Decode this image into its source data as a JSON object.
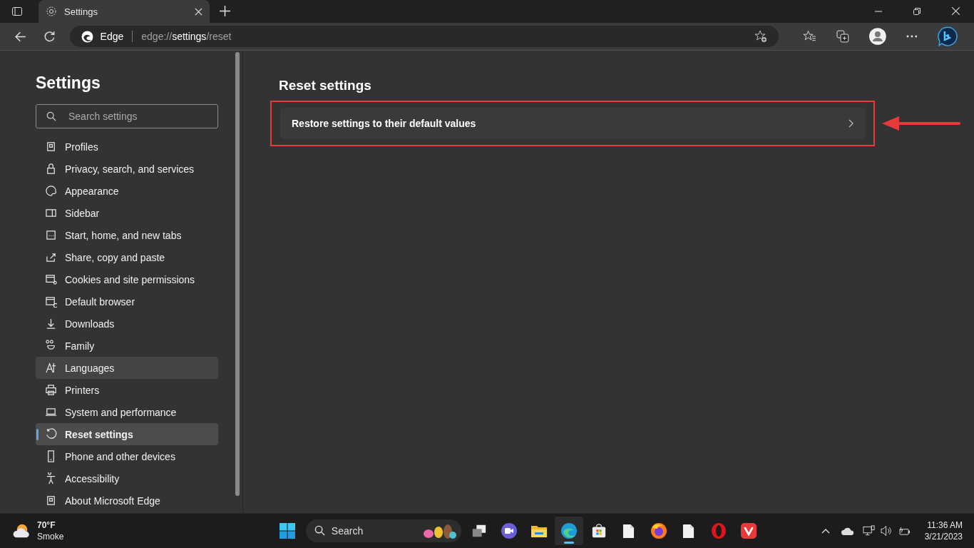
{
  "tab": {
    "title": "Settings"
  },
  "address_bar": {
    "site_label": "Edge",
    "url_scheme": "edge://",
    "url_host": "settings",
    "url_path": "/reset"
  },
  "sidebar": {
    "title": "Settings",
    "search": {
      "placeholder": "Search settings"
    },
    "items": [
      {
        "label": "Profiles",
        "selected": false,
        "hovered": false
      },
      {
        "label": "Privacy, search, and services",
        "selected": false,
        "hovered": false
      },
      {
        "label": "Appearance",
        "selected": false,
        "hovered": false
      },
      {
        "label": "Sidebar",
        "selected": false,
        "hovered": false
      },
      {
        "label": "Start, home, and new tabs",
        "selected": false,
        "hovered": false
      },
      {
        "label": "Share, copy and paste",
        "selected": false,
        "hovered": false
      },
      {
        "label": "Cookies and site permissions",
        "selected": false,
        "hovered": false
      },
      {
        "label": "Default browser",
        "selected": false,
        "hovered": false
      },
      {
        "label": "Downloads",
        "selected": false,
        "hovered": false
      },
      {
        "label": "Family",
        "selected": false,
        "hovered": false
      },
      {
        "label": "Languages",
        "selected": false,
        "hovered": true
      },
      {
        "label": "Printers",
        "selected": false,
        "hovered": false
      },
      {
        "label": "System and performance",
        "selected": false,
        "hovered": false
      },
      {
        "label": "Reset settings",
        "selected": true,
        "hovered": false
      },
      {
        "label": "Phone and other devices",
        "selected": false,
        "hovered": false
      },
      {
        "label": "Accessibility",
        "selected": false,
        "hovered": false
      },
      {
        "label": "About Microsoft Edge",
        "selected": false,
        "hovered": false
      }
    ]
  },
  "content": {
    "title": "Reset settings",
    "rows": [
      {
        "label": "Restore settings to their default values",
        "highlighted": true
      }
    ]
  },
  "taskbar": {
    "weather": {
      "temperature": "70°F",
      "condition": "Smoke"
    },
    "search": {
      "placeholder": "Search"
    },
    "apps": [
      {
        "kind": "task-view",
        "selected": false
      },
      {
        "kind": "meet",
        "selected": false
      },
      {
        "kind": "folder",
        "selected": false
      },
      {
        "kind": "edge",
        "selected": true
      },
      {
        "kind": "store",
        "selected": false
      },
      {
        "kind": "file",
        "selected": false
      },
      {
        "kind": "firefox",
        "selected": false
      },
      {
        "kind": "file",
        "selected": false
      },
      {
        "kind": "opera",
        "selected": false
      },
      {
        "kind": "vivaldi",
        "selected": false
      }
    ],
    "time": "11:36 AM",
    "date": "3/21/2023"
  }
}
